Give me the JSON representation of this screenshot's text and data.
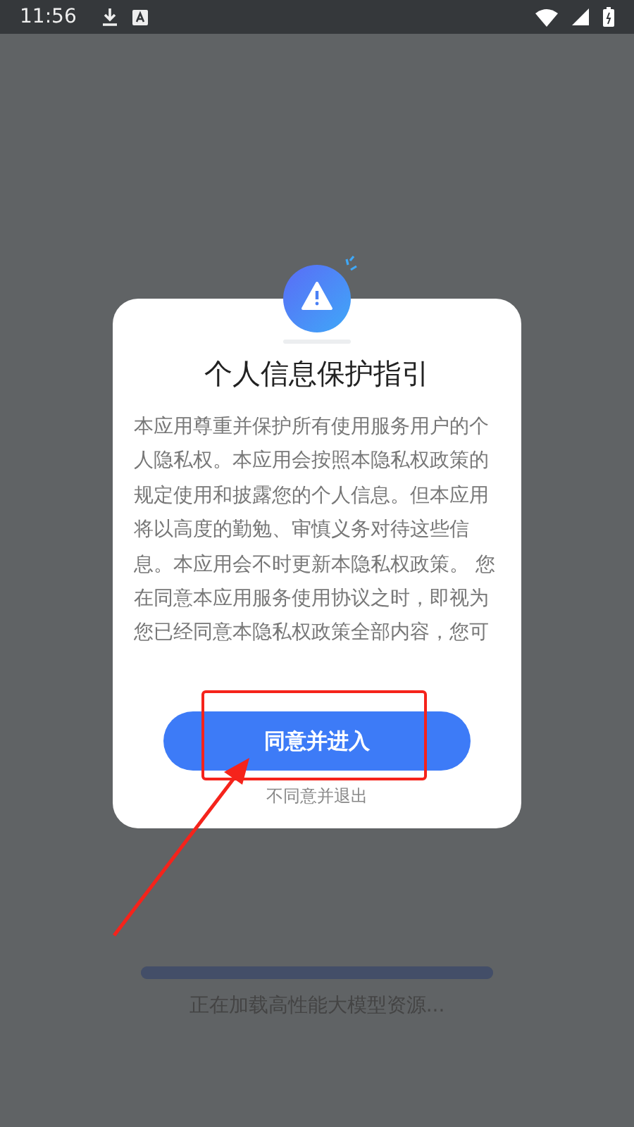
{
  "status_bar": {
    "time": "11:56"
  },
  "dialog": {
    "title": "个人信息保护指引",
    "body": "本应用尊重并保护所有使用服务用户的个人隐私权。本应用会按照本隐私权政策的规定使用和披露您的个人信息。但本应用将以高度的勤勉、审慎义务对待这些信息。本应用会不时更新本隐私权政策。 您在同意本应用服务使用协议之时，即视为您已经同意本隐私权政策全部内容，您可",
    "accept_button": "同意并进入",
    "decline_link": "不同意并退出"
  },
  "loading": {
    "level": 1,
    "text": "正在加载高性能大模型资源..."
  }
}
